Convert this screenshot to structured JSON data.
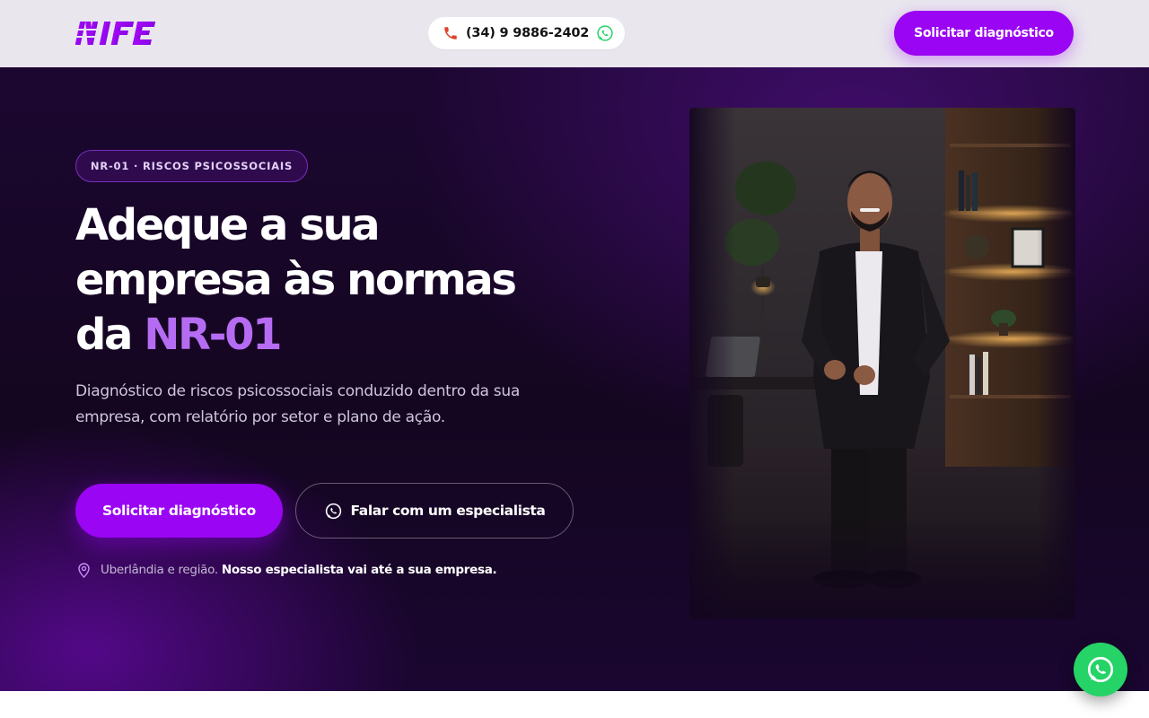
{
  "header": {
    "logo_text": "NIFE",
    "phone": "(34) 9 9886-2402",
    "cta_label": "Solicitar diagnóstico"
  },
  "hero": {
    "badge": "NR-01 · RISCOS PSICOSSOCIAIS",
    "headline_line1": "Adeque a sua",
    "headline_line2": "empresa às normas",
    "headline_line3_prefix": "da ",
    "headline_line3_accent": "NR-01",
    "subtext": "Diagnóstico de riscos psicossociais conduzido dentro da sua empresa, com relatório por setor e plano de ação.",
    "primary_cta": "Solicitar diagnóstico",
    "secondary_cta": "Falar com um especialista",
    "location_regular": "Uberlândia e região.",
    "location_bold": "Nosso especialista vai até a sua empresa."
  },
  "icons": {
    "phone": "phone-icon",
    "whatsapp": "whatsapp-icon",
    "location": "location-pin-icon",
    "floating": "whatsapp-icon"
  },
  "colors": {
    "accent": "#9a05f3",
    "accent_light": "#b56cf3",
    "header_bg": "#e9e6ee",
    "hero_bg": "#140620",
    "whatsapp": "#25d366"
  }
}
